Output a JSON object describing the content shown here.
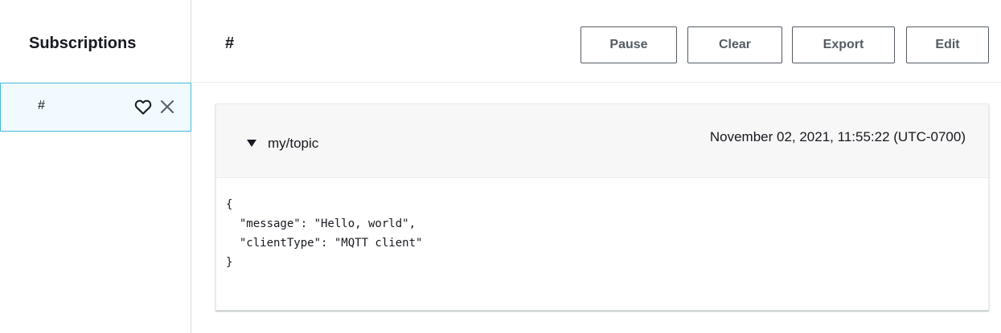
{
  "sidebar": {
    "title": "Subscriptions",
    "subscriptions": [
      {
        "topic": "#",
        "favorite_icon": "heart-outline-icon",
        "remove_icon": "close-icon",
        "selected": true
      }
    ]
  },
  "main": {
    "title": "#",
    "buttons": {
      "pause": "Pause",
      "clear": "Clear",
      "export": "Export",
      "edit": "Edit"
    },
    "messages": [
      {
        "topic": "my/topic",
        "timestamp": "November 02, 2021, 11:55:22 (UTC-0700)",
        "expanded": true,
        "payload": "{\n  \"message\": \"Hello, world\",\n  \"clientType\": \"MQTT client\"\n}"
      }
    ]
  },
  "colors": {
    "selected_border": "#44b9d6",
    "selected_background": "#f1faff",
    "button_border": "#545b64",
    "message_header_background": "#f7f7f7"
  }
}
